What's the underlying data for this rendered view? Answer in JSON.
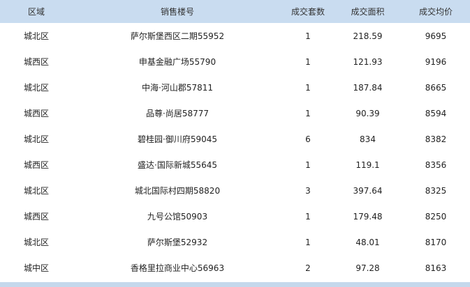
{
  "columns": [
    "区域",
    "销售楼号",
    "成交套数",
    "成交面积",
    "成交均价"
  ],
  "rows": [
    {
      "district": "城北区",
      "building": "萨尔斯堡西区二期55952",
      "units": "1",
      "area": "218.59",
      "avg_price": "9695"
    },
    {
      "district": "城西区",
      "building": "申基金融广场55790",
      "units": "1",
      "area": "121.93",
      "avg_price": "9196"
    },
    {
      "district": "城北区",
      "building": "中海·河山郡57811",
      "units": "1",
      "area": "187.84",
      "avg_price": "8665"
    },
    {
      "district": "城西区",
      "building": "品尊·尚居58777",
      "units": "1",
      "area": "90.39",
      "avg_price": "8594"
    },
    {
      "district": "城北区",
      "building": "碧桂园·御川府59045",
      "units": "6",
      "area": "834",
      "avg_price": "8382"
    },
    {
      "district": "城西区",
      "building": "盛达·国际新城55645",
      "units": "1",
      "area": "119.1",
      "avg_price": "8356"
    },
    {
      "district": "城北区",
      "building": "城北国际村四期58820",
      "units": "3",
      "area": "397.64",
      "avg_price": "8325"
    },
    {
      "district": "城西区",
      "building": "九号公馆50903",
      "units": "1",
      "area": "179.48",
      "avg_price": "8250"
    },
    {
      "district": "城北区",
      "building": "萨尔斯堡52932",
      "units": "1",
      "area": "48.01",
      "avg_price": "8170"
    },
    {
      "district": "城中区",
      "building": "香格里拉商业中心56963",
      "units": "2",
      "area": "97.28",
      "avg_price": "8163"
    }
  ]
}
